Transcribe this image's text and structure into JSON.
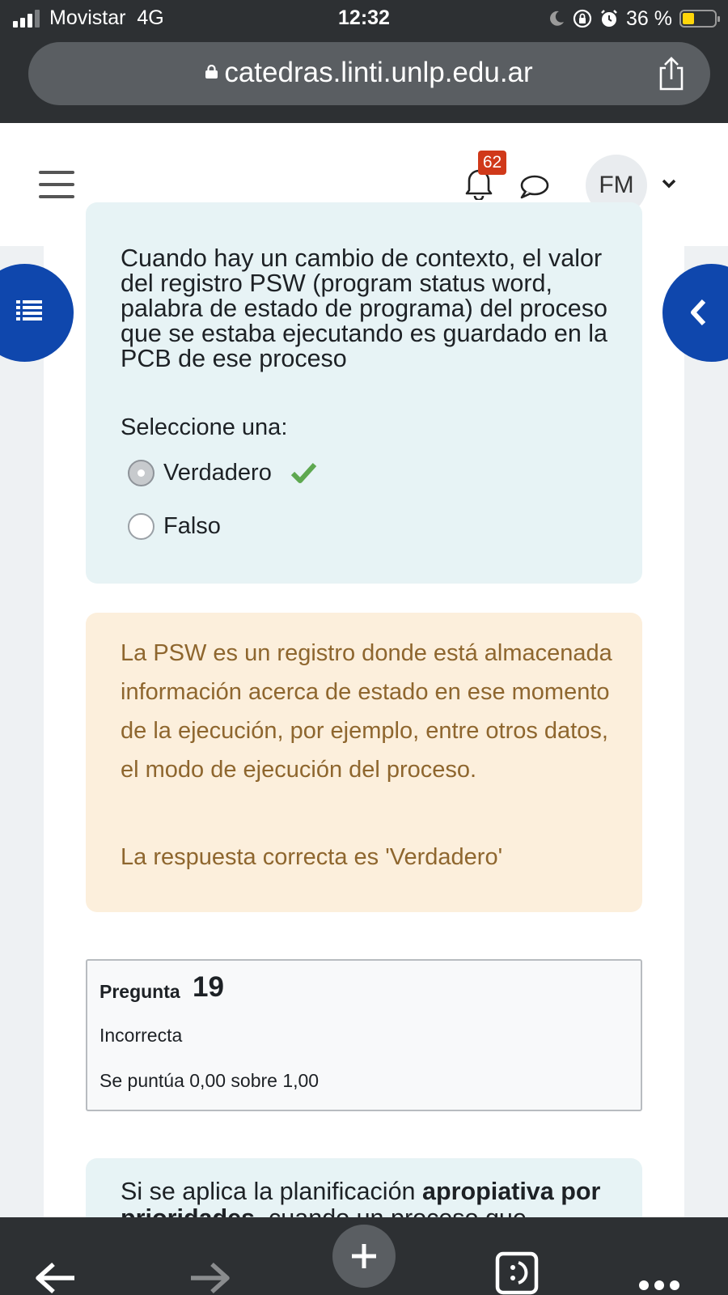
{
  "status_bar": {
    "carrier": "Movistar",
    "network": "4G",
    "time": "12:32",
    "battery": "36 %",
    "battery_level": 0.36
  },
  "browser": {
    "url": "catedras.linti.unlp.edu.ar"
  },
  "navbar": {
    "notification_count": "62",
    "user_initials": "FM"
  },
  "question": {
    "text": "Cuando hay un cambio de contexto, el valor del registro PSW (program status word, palabra de estado de programa) del proceso que se estaba ejecutando es guardado en la PCB de ese proceso",
    "select_label": "Seleccione una:",
    "options": [
      {
        "label": "Verdadero",
        "selected": true,
        "correct": true
      },
      {
        "label": "Falso",
        "selected": false,
        "correct": false
      }
    ]
  },
  "feedback": {
    "text": "La PSW es un registro donde está almacenada información acerca de estado en ese momento de la ejecución, por ejemplo, entre otros datos, el modo de ejecución del proceso.",
    "right_answer": "La respuesta correcta es 'Verdadero'"
  },
  "next_question_info": {
    "label": "Pregunta",
    "number": "19",
    "state": "Incorrecta",
    "grade": "Se puntúa 0,00 sobre 1,00"
  },
  "next_question": {
    "text_before": "Si se aplica la planificación ",
    "text_bold": "apropiativa por prioridades",
    "text_after": ", cuando un proceso que"
  },
  "colors": {
    "accent": "#0f47ad",
    "badge": "#d0391a",
    "question_bg": "#e7f3f5",
    "feedback_bg": "#fcefdc",
    "feedback_text": "#8e662e",
    "correct": "#5ea850"
  }
}
